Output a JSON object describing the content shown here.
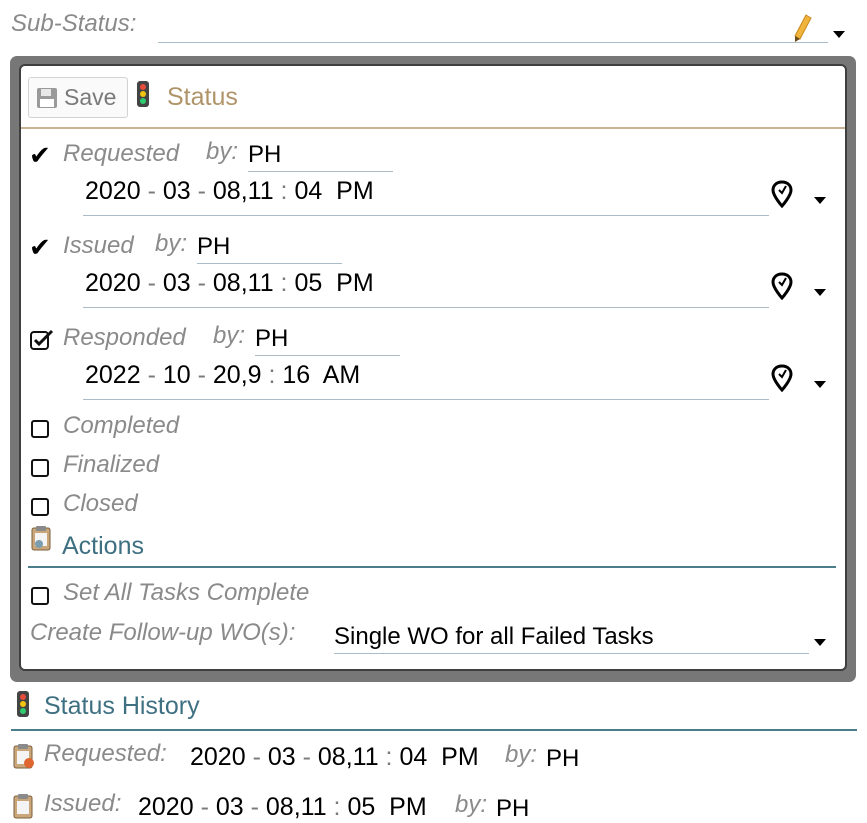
{
  "substatus": {
    "label": "Sub-Status:",
    "value": ""
  },
  "toolbar": {
    "save_label": "Save"
  },
  "status": {
    "title": "Status",
    "by_label": "by:",
    "steps": [
      {
        "label": "Requested",
        "by": "PH",
        "date": {
          "y": "2020",
          "m": "03",
          "d": "08",
          "h": "11",
          "min": "04",
          "ampm": "PM"
        },
        "state": "done"
      },
      {
        "label": "Issued",
        "by": "PH",
        "date": {
          "y": "2020",
          "m": "03",
          "d": "08",
          "h": "11",
          "min": "05",
          "ampm": "PM"
        },
        "state": "done"
      },
      {
        "label": "Responded",
        "by": "PH",
        "date": {
          "y": "2022",
          "m": "10",
          "d": "20",
          "h": "9",
          "min": "16",
          "ampm": "AM"
        },
        "state": "checked"
      }
    ],
    "unchecked": [
      "Completed",
      "Finalized",
      "Closed"
    ]
  },
  "actions": {
    "title": "Actions",
    "set_all_label": "Set All Tasks Complete",
    "followup_label": "Create Follow-up WO(s):",
    "followup_value": "Single WO for all Failed Tasks"
  },
  "history": {
    "title": "Status History",
    "by_label": "by:",
    "entries": [
      {
        "label": "Requested:",
        "date": {
          "y": "2020",
          "m": "03",
          "d": "08",
          "h": "11",
          "min": "04",
          "ampm": "PM"
        },
        "by": "PH"
      },
      {
        "label": "Issued:",
        "date": {
          "y": "2020",
          "m": "03",
          "d": "08",
          "h": "11",
          "min": "05",
          "ampm": "PM"
        },
        "by": "PH"
      }
    ]
  },
  "colors": {
    "status_accent": "#b09469",
    "actions_accent": "#3e7082",
    "panel_border": "#777777"
  },
  "icons": [
    "pencil-icon",
    "chevron-down-icon",
    "floppy-disk-icon",
    "traffic-light-icon",
    "checkmark-icon",
    "location-pin-icon",
    "checkbox-checked-icon",
    "checkbox-icon",
    "clipboard-icon"
  ]
}
